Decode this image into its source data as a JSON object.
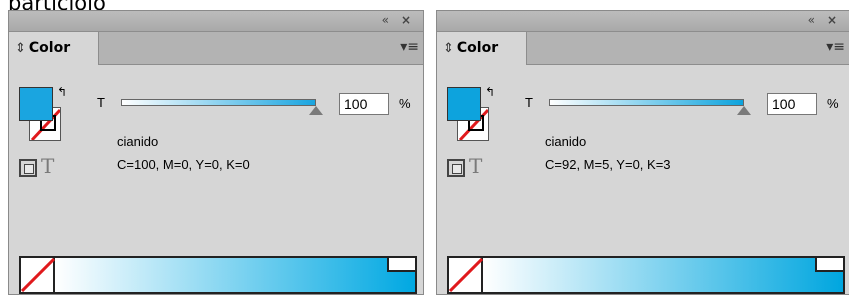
{
  "background_text": "particiolo",
  "panels": [
    {
      "collapse_icon": "«",
      "close_icon": "×",
      "tab_label": "Color",
      "tint_label": "T",
      "tint_value": "100",
      "tint_unit": "%",
      "tint_percent": 100,
      "swatch_name": "cianido",
      "cmyk": "C=100, M=0, Y=0, K=0",
      "fill_color": "#1aa5e0",
      "ramp_color": "#00a8e2"
    },
    {
      "collapse_icon": "«",
      "close_icon": "×",
      "tab_label": "Color",
      "tint_label": "T",
      "tint_value": "100",
      "tint_unit": "%",
      "tint_percent": 100,
      "swatch_name": "cianido",
      "cmyk": "C=92, M=5, Y=0, K=3",
      "fill_color": "#0da3dd",
      "ramp_color": "#00a6df"
    }
  ]
}
